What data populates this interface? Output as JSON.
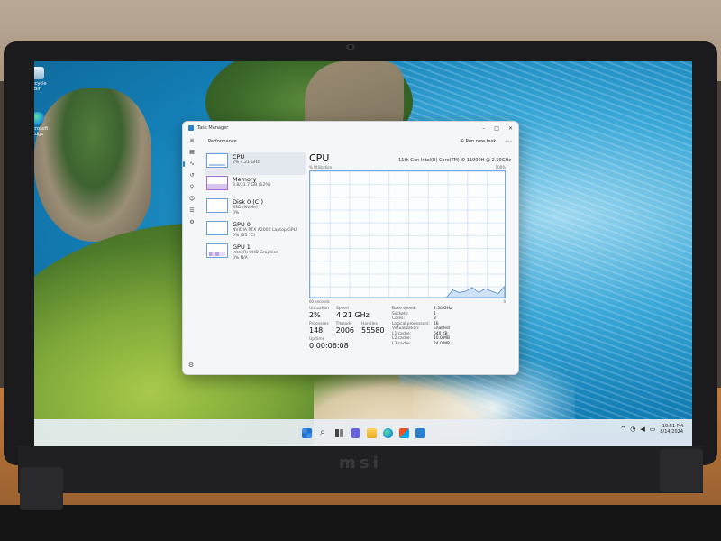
{
  "desktop": {
    "icons": [
      {
        "label": "Recycle Bin"
      },
      {
        "label": "Microsoft Edge"
      }
    ]
  },
  "task_manager": {
    "window_title": "Task Manager",
    "section": "Performance",
    "run_task_label": "Run new task",
    "devices": [
      {
        "name": "CPU",
        "sub1": "2% 4.21 GHz",
        "sub2": ""
      },
      {
        "name": "Memory",
        "sub1": "3.8/31.7 GB (12%)",
        "sub2": ""
      },
      {
        "name": "Disk 0 (C:)",
        "sub1": "SSD (NVMe)",
        "sub2": "0%"
      },
      {
        "name": "GPU 0",
        "sub1": "NVIDIA RTX A2000 Laptop GPU",
        "sub2": "0% (35 °C)"
      },
      {
        "name": "GPU 1",
        "sub1": "Intel(R) UHD Graphics",
        "sub2": "0% N/A"
      }
    ],
    "detail": {
      "title": "CPU",
      "processor": "11th Gen Intel(R) Core(TM) i9-11900H @ 2.50GHz",
      "graph_label": "% Utilization",
      "graph_max": "100%",
      "graph_time": "60 seconds",
      "graph_min": "0",
      "stats": {
        "utilization_label": "Utilization",
        "utilization": "2%",
        "speed_label": "Speed",
        "speed": "4.21 GHz",
        "processes_label": "Processes",
        "processes": "148",
        "threads_label": "Threads",
        "threads": "2006",
        "handles_label": "Handles",
        "handles": "55580",
        "uptime_label": "Up time",
        "uptime": "0:00:06:08"
      },
      "specs": [
        {
          "k": "Base speed:",
          "v": "2.50 GHz"
        },
        {
          "k": "Sockets:",
          "v": "1"
        },
        {
          "k": "Cores:",
          "v": "8"
        },
        {
          "k": "Logical processors:",
          "v": "16"
        },
        {
          "k": "Virtualization:",
          "v": "Enabled"
        },
        {
          "k": "L1 cache:",
          "v": "640 KB"
        },
        {
          "k": "L2 cache:",
          "v": "10.0 MB"
        },
        {
          "k": "L3 cache:",
          "v": "24.0 MB"
        }
      ]
    }
  },
  "chart_data": {
    "type": "area",
    "ylabel": "% Utilization",
    "xlabel": "60 seconds",
    "ylim": [
      0,
      100
    ],
    "x": [
      0,
      2,
      4,
      6,
      8,
      10,
      12,
      14,
      16,
      18,
      20,
      22,
      24,
      26,
      28,
      30,
      32,
      34,
      36,
      38,
      40,
      42,
      44,
      46,
      48,
      50,
      52,
      54,
      56,
      58,
      60
    ],
    "values": [
      0,
      0,
      0,
      0,
      0,
      0,
      0,
      0,
      0,
      0,
      0,
      0,
      0,
      0,
      0,
      0,
      0,
      0,
      0,
      0,
      0,
      0,
      6,
      4,
      5,
      8,
      4,
      7,
      5,
      3,
      9
    ]
  },
  "taskbar": {
    "clock_time": "10:51 PM",
    "clock_date": "8/14/2024"
  },
  "laptop": {
    "brand": "msi"
  }
}
